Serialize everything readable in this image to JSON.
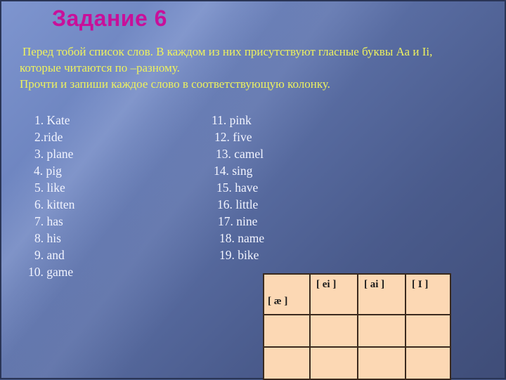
{
  "slide": {
    "title": "Задание 6",
    "instructions": [
      " Перед тобой список слов. В каждом из них присутствуют гласные буквы Аа и Ii,",
      "которые читаются по –разному.",
      "Прочти и запиши каждое слово в соответствующую колонку."
    ],
    "words_left": [
      "1. Kate",
      "2.ride",
      "3. plane",
      "4. pig",
      "5. like",
      "6. kitten",
      "7. has",
      "8. his",
      "9. and",
      "10. game"
    ],
    "words_right": [
      "11. pink",
      "12. five",
      "13. camel",
      "14. sing",
      "15. have",
      "16. little",
      "17. nine",
      "18. name",
      "19. bike"
    ],
    "table": {
      "headers": [
        "[ æ ]",
        "[ ei ]",
        "[ ai ]",
        "[ I ]"
      ],
      "rows": [
        [
          "",
          "",
          "",
          ""
        ],
        [
          "",
          "",
          "",
          ""
        ]
      ]
    },
    "colors": {
      "title": "#c8109a",
      "instructions": "#eef25e",
      "words": "#f2f4ff",
      "table_fill": "#fcd8b4",
      "background": "#4a5c8a"
    }
  }
}
